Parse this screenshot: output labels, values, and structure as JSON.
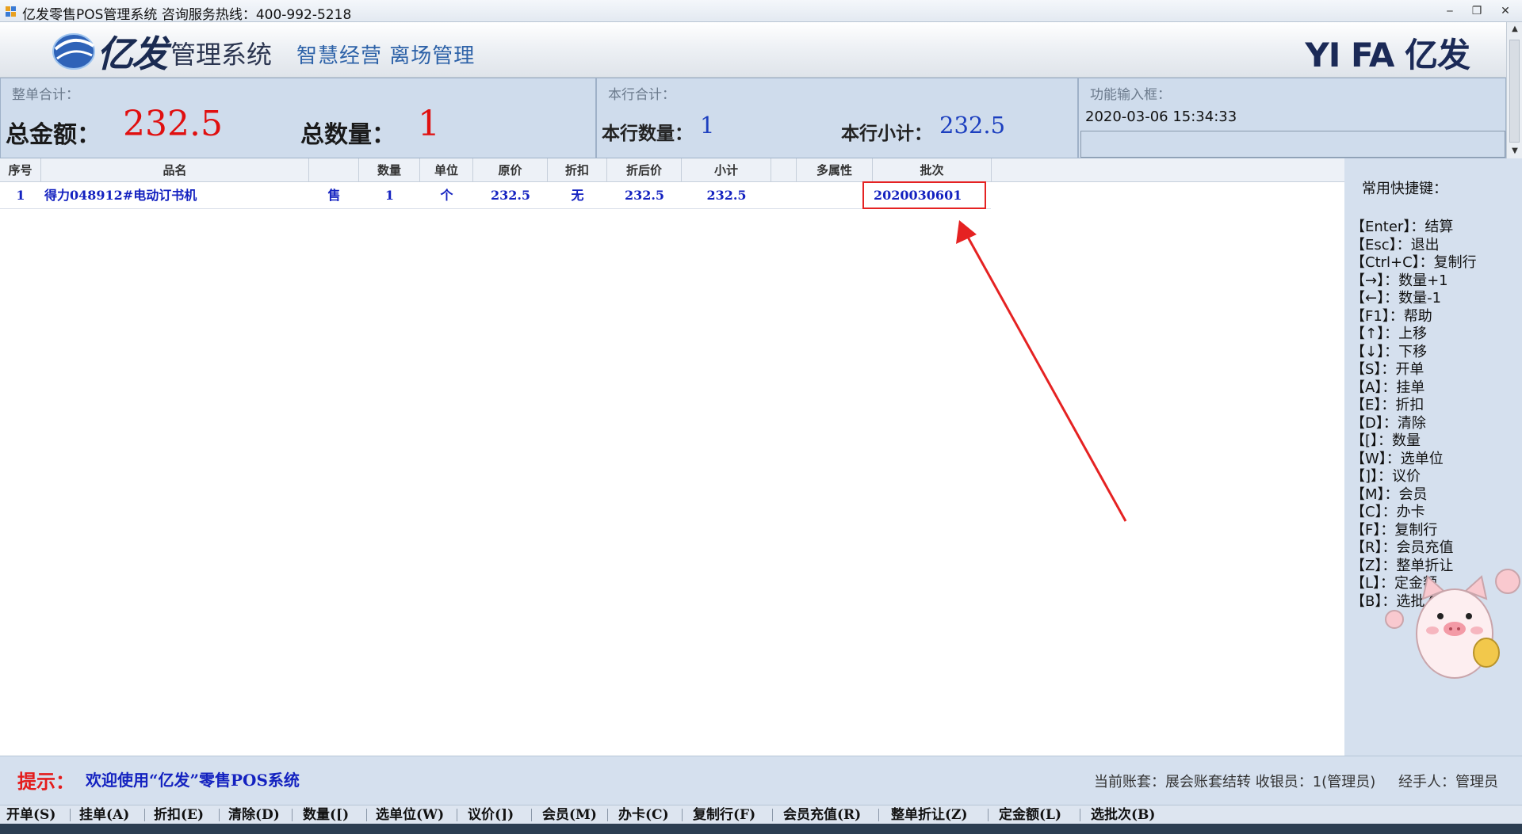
{
  "window": {
    "title": "亿发零售POS管理系统 咨询服务热线：400-992-5218",
    "minimize_glyph": "‒",
    "restore_glyph": "❐",
    "close_glyph": "✕"
  },
  "banner": {
    "logo_name": "亿发",
    "logo_sys": "管理系统",
    "slogan": "智慧经营  离场管理",
    "brand_right": "YI FA 亿发"
  },
  "summary": {
    "section_title": "整单合计：",
    "total_amount_label": "总金额：",
    "total_amount": "232.5",
    "total_qty_label": "总数量：",
    "total_qty": "1"
  },
  "row_summary": {
    "section_title": "本行合计：",
    "row_qty_label": "本行数量：",
    "row_qty": "1",
    "row_subtotal_label": "本行小计：",
    "row_subtotal": "232.5"
  },
  "function_input": {
    "section_title": "功能输入框：",
    "datetime": "2020-03-06 15:34:33",
    "value": ""
  },
  "grid": {
    "columns": [
      "序号",
      "品名",
      "",
      "数量",
      "单位",
      "原价",
      "折扣",
      "折后价",
      "小计",
      "",
      "多属性",
      "批次"
    ],
    "rows": [
      {
        "seq": "1",
        "name": "得力048912#电动订书机",
        "mode": "售",
        "qty": "1",
        "unit": "个",
        "price": "232.5",
        "discount": "无",
        "discounted_price": "232.5",
        "subtotal": "232.5",
        "attrs": "",
        "batch": "2020030601"
      }
    ]
  },
  "shortcuts": {
    "title": "常用快捷键：",
    "items": [
      "【Enter】：结算",
      "【Esc】：退出",
      "【Ctrl+C】：复制行",
      "【→】：数量+1",
      "【←】：数量-1",
      "【F1】：帮助",
      "【↑】：上移",
      "【↓】：下移",
      "【S】：开单",
      "【A】：挂单",
      "【E】：折扣",
      "【D】：清除",
      "【[】：数量",
      "【W】：选单位",
      "【]】：议价",
      "【M】：会员",
      "【C】：办卡",
      "【F】：复制行",
      "【R】：会员充值",
      "【Z】：整单折让",
      "【L】：定金额",
      "【B】：选批次"
    ]
  },
  "status": {
    "hint_label": "提示：",
    "hint_text": "欢迎使用“亿发”零售POS系统",
    "account": "当前账套：展会账套结转 收银员：1(管理员)",
    "operator": "经手人：管理员"
  },
  "function_bar": [
    "开单(S)",
    "挂单(A)",
    "折扣(E)",
    "清除(D)",
    "数量([)",
    "选单位(W)",
    "议价(])",
    "会员(M)",
    "办卡(C)",
    "复制行(F)",
    "会员充值(R)",
    "整单折让(Z)",
    "定金额(L)",
    "选批次(B)"
  ],
  "colors": {
    "panel_bg": "#cfdcec",
    "amount_red": "#e01010",
    "row_text_blue": "#1422c0",
    "highlight_red": "#e52222"
  }
}
